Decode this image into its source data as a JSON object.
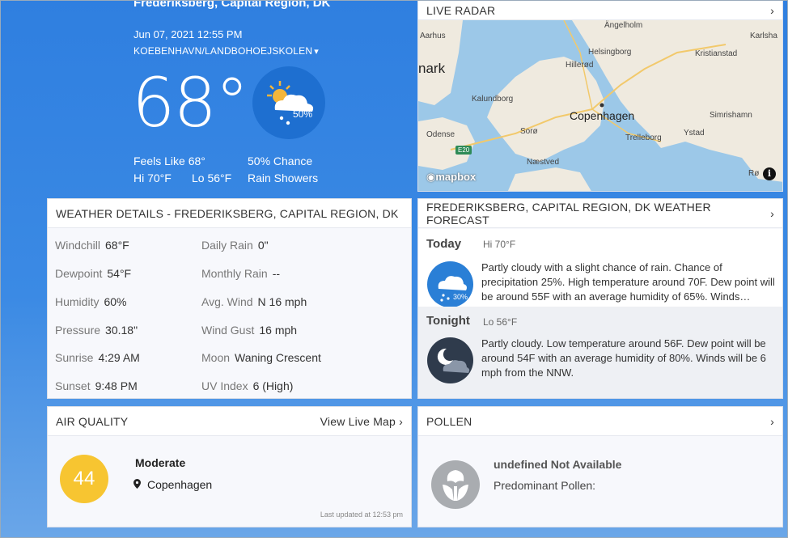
{
  "current": {
    "location": "Frederiksberg, Capital Region, DK",
    "datetime": "Jun 07, 2021 12:55 PM",
    "station": "KOEBENHAVN/LANDBOHOEJSKOLEN",
    "temperature": "68°",
    "precip_chance_badge": "50%",
    "feels_like": "Feels Like 68°",
    "hi": "Hi 70°F",
    "lo": "Lo 56°F",
    "chance": "50% Chance",
    "condition": "Rain Showers",
    "icon": "partly-cloudy-rain-icon"
  },
  "radar": {
    "title": "LIVE RADAR",
    "labels": {
      "aarhus": "Aarhus",
      "denmark": "nark",
      "angelholm": "Ängelholm",
      "karlshamn": "Karlsha",
      "helsingborg": "Helsingborg",
      "kristianstad": "Kristianstad",
      "hillerod": "Hillerød",
      "kalundborg": "Kalundborg",
      "copenhagen": "Copenhagen",
      "odense": "Odense",
      "soro": "Sorø",
      "ystad": "Ystad",
      "simrishamn": "Simrishamn",
      "trelleborg": "Trelleborg",
      "naestved": "Næstved",
      "ronne": "Rø"
    },
    "road": "E20",
    "attribution": "mapbox",
    "colors": {
      "water": "#9cc8e8",
      "land": "#efeadf",
      "road": "#f2c96b"
    }
  },
  "details": {
    "title": "WEATHER DETAILS - FREDERIKSBERG, CAPITAL REGION, DK",
    "rows": [
      {
        "label": "Windchill",
        "value": "68°F"
      },
      {
        "label": "Daily Rain",
        "value": "0\""
      },
      {
        "label": "Dewpoint",
        "value": "54°F"
      },
      {
        "label": "Monthly Rain",
        "value": "--"
      },
      {
        "label": "Humidity",
        "value": "60%"
      },
      {
        "label": "Avg. Wind",
        "value": "N 16 mph"
      },
      {
        "label": "Pressure",
        "value": "30.18\""
      },
      {
        "label": "Wind Gust",
        "value": "16 mph"
      },
      {
        "label": "Sunrise",
        "value": "4:29 AM"
      },
      {
        "label": "Moon",
        "value": "Waning Crescent"
      },
      {
        "label": "Sunset",
        "value": "9:48 PM"
      },
      {
        "label": "UV Index",
        "value": "6 (High)"
      }
    ]
  },
  "forecast": {
    "title": "FREDERIKSBERG, CAPITAL REGION, DK WEATHER FORECAST",
    "today": {
      "label": "Today",
      "hilo": "Hi 70°F",
      "badge": "30%",
      "text": "Partly cloudy with a slight chance of rain. Chance of precipitation 25%. High temperature around 70F. Dew point will be around 55F with an average humidity of 65%. Winds…"
    },
    "tonight": {
      "label": "Tonight",
      "hilo": "Lo 56°F",
      "text": "Partly cloudy. Low temperature around 56F. Dew point will be around 54F with an average humidity of 80%. Winds will be 6 mph from the NNW."
    }
  },
  "air": {
    "title": "AIR QUALITY",
    "link": "View Live Map",
    "aqi": "44",
    "level": "Moderate",
    "city": "Copenhagen",
    "updated": "Last updated at 12:53 pm",
    "color": "#f7c531"
  },
  "pollen": {
    "title": "POLLEN",
    "status": "undefined Not Available",
    "predominant": "Predominant Pollen:"
  }
}
